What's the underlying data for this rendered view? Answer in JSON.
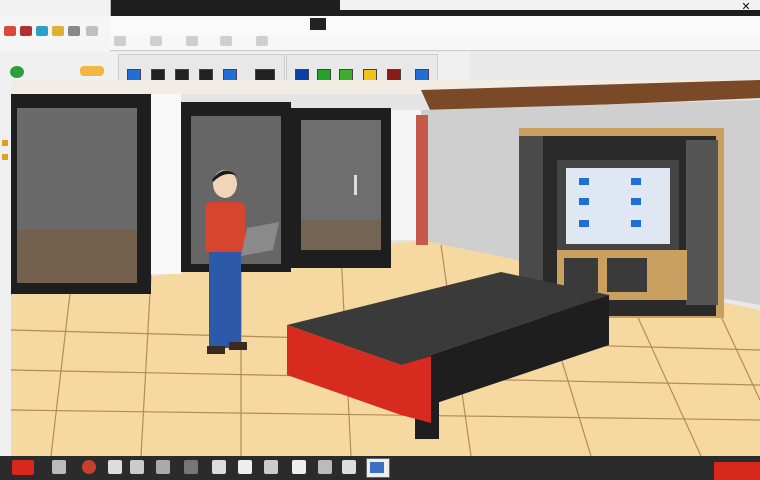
{
  "title_bar": {
    "left_text": "",
    "left_text_2": "",
    "close_symbol": "✕"
  },
  "toolbar": {
    "palette_colors_1": [
      "#1f6fd6",
      "#222222",
      "#222222",
      "#222222",
      "#1f6fd6",
      "#222222"
    ],
    "palette_colors_2": [
      "#0a3fa8",
      "#23a32a",
      "#3cae2c",
      "#f2c318",
      "#8a1a1a",
      "#1f6fd6"
    ]
  },
  "scene": {
    "floor_color": "#f5d9a0",
    "tile_line_color": "#b58c55",
    "wall_color": "#e4e4e4",
    "beam_color": "#7a4a28",
    "platform_color": "#d62b1e",
    "platform_top_color": "#3a3a3a",
    "cabinet_color": "#caa060",
    "screen_color": "#dfe7f3",
    "person_shirt_color": "#d8452f",
    "person_pants_color": "#2d5aa8"
  },
  "taskbar": {
    "icons": [
      "record",
      "folder",
      "browser",
      "play",
      "window",
      "tab",
      "note",
      "photo",
      "pen",
      "tool",
      "cloud",
      "app"
    ]
  }
}
